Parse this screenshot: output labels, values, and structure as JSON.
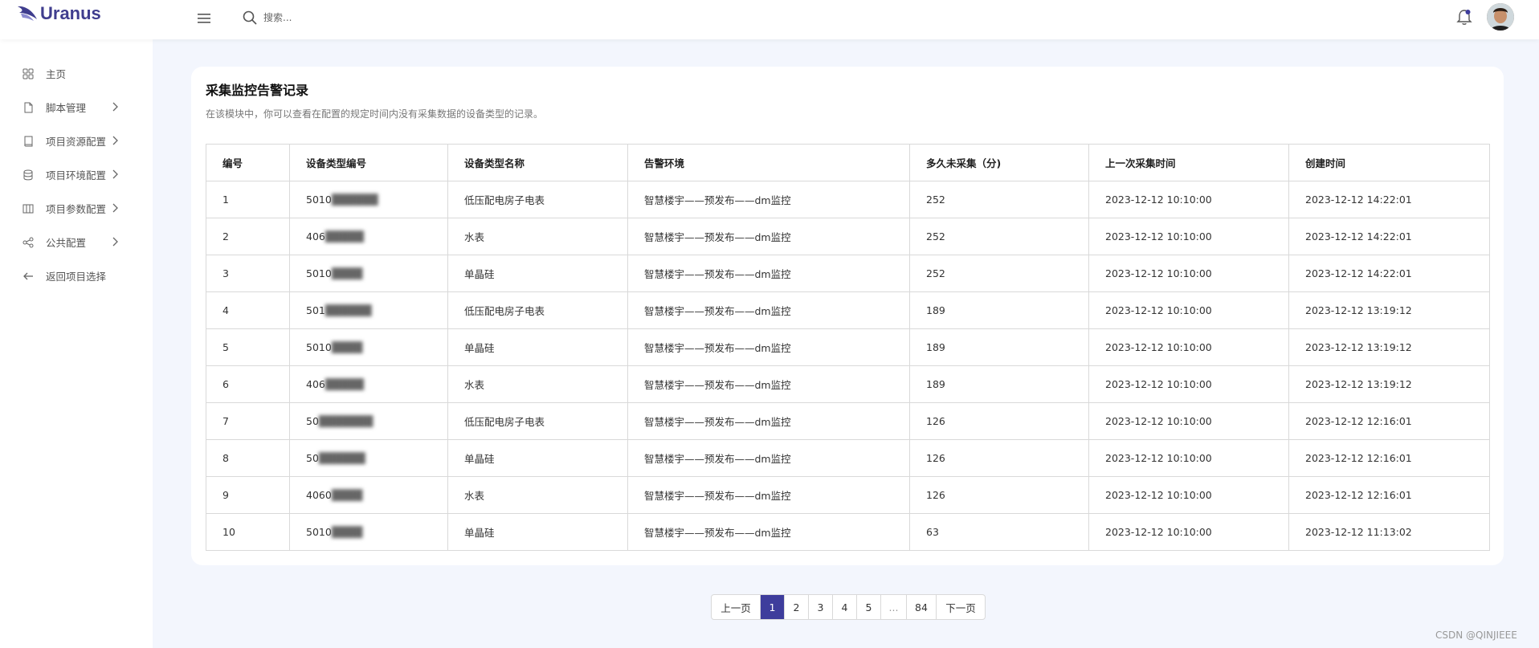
{
  "header": {
    "logo_text": "Uranus",
    "search_placeholder": "搜索..."
  },
  "sidebar": {
    "items": [
      {
        "label": "主页",
        "icon": "grid-icon",
        "has_children": false
      },
      {
        "label": "脚本管理",
        "icon": "file-icon",
        "has_children": true
      },
      {
        "label": "项目资源配置",
        "icon": "book-icon",
        "has_children": true
      },
      {
        "label": "项目环境配置",
        "icon": "database-icon",
        "has_children": true
      },
      {
        "label": "项目参数配置",
        "icon": "columns-icon",
        "has_children": true
      },
      {
        "label": "公共配置",
        "icon": "share-icon",
        "has_children": true
      },
      {
        "label": "返回项目选择",
        "icon": "arrow-left-icon",
        "has_children": false
      }
    ]
  },
  "main": {
    "title": "采集监控告警记录",
    "description": "在该模块中，你可以查看在配置的规定时间内没有采集数据的设备类型的记录。"
  },
  "table": {
    "columns": [
      "编号",
      "设备类型编号",
      "设备类型名称",
      "告警环境",
      "多久未采集（分)",
      "上一次采集时间",
      "创建时间"
    ],
    "rows": [
      [
        "1",
        "5010██████",
        "低压配电房子电表",
        "智慧楼宇——预发布——dm监控",
        "252",
        "2023-12-12 10:10:00",
        "2023-12-12 14:22:01"
      ],
      [
        "2",
        "406█████",
        "水表",
        "智慧楼宇——预发布——dm监控",
        "252",
        "2023-12-12 10:10:00",
        "2023-12-12 14:22:01"
      ],
      [
        "3",
        "5010████",
        "单晶硅",
        "智慧楼宇——预发布——dm监控",
        "252",
        "2023-12-12 10:10:00",
        "2023-12-12 14:22:01"
      ],
      [
        "4",
        "501██████",
        "低压配电房子电表",
        "智慧楼宇——预发布——dm监控",
        "189",
        "2023-12-12 10:10:00",
        "2023-12-12 13:19:12"
      ],
      [
        "5",
        "5010████",
        "单晶硅",
        "智慧楼宇——预发布——dm监控",
        "189",
        "2023-12-12 10:10:00",
        "2023-12-12 13:19:12"
      ],
      [
        "6",
        "406█████",
        "水表",
        "智慧楼宇——预发布——dm监控",
        "189",
        "2023-12-12 10:10:00",
        "2023-12-12 13:19:12"
      ],
      [
        "7",
        "50███████",
        "低压配电房子电表",
        "智慧楼宇——预发布——dm监控",
        "126",
        "2023-12-12 10:10:00",
        "2023-12-12 12:16:01"
      ],
      [
        "8",
        "50██████",
        "单晶硅",
        "智慧楼宇——预发布——dm监控",
        "126",
        "2023-12-12 10:10:00",
        "2023-12-12 12:16:01"
      ],
      [
        "9",
        "4060████",
        "水表",
        "智慧楼宇——预发布——dm监控",
        "126",
        "2023-12-12 10:10:00",
        "2023-12-12 12:16:01"
      ],
      [
        "10",
        "5010████",
        "单晶硅",
        "智慧楼宇——预发布——dm监控",
        "63",
        "2023-12-12 10:10:00",
        "2023-12-12 11:13:02"
      ]
    ]
  },
  "pagination": {
    "prev_label": "上一页",
    "next_label": "下一页",
    "pages": [
      "1",
      "2",
      "3",
      "4",
      "5",
      "...",
      "84"
    ],
    "current_page": "1"
  },
  "watermark": "CSDN @QINJIEEE",
  "colors": {
    "accent": "#3e3d9c",
    "background": "#f3f6fd",
    "logo": "#3f3d8e"
  }
}
